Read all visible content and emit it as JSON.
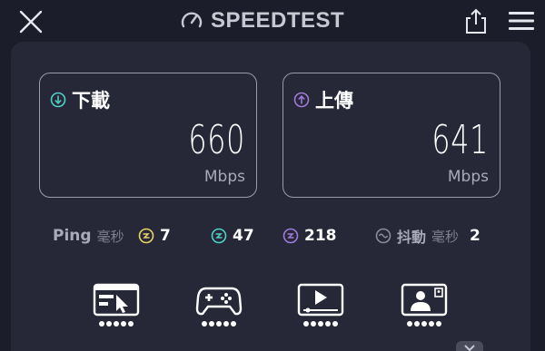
{
  "header": {
    "title": "SPEEDTEST"
  },
  "download": {
    "label": "下載",
    "value": "660",
    "unit": "Mbps"
  },
  "upload": {
    "label": "上傳",
    "value": "641",
    "unit": "Mbps"
  },
  "ping": {
    "label": "Ping",
    "unit_label": "毫秒",
    "idle": "7",
    "download": "47",
    "upload": "218"
  },
  "jitter": {
    "label": "抖動",
    "unit_label": "毫秒",
    "value": "2"
  },
  "activities": [
    {
      "icon": "browsing-icon",
      "rating_dots": 5
    },
    {
      "icon": "gaming-icon",
      "rating_dots": 5
    },
    {
      "icon": "video-streaming-icon",
      "rating_dots": 5
    },
    {
      "icon": "video-call-icon",
      "rating_dots": 5
    }
  ],
  "colors": {
    "background": "#1b1d2a",
    "panel": "#262838",
    "download_accent": "#4fd1c5",
    "upload_accent": "#a07bd8",
    "idle_ping": "#e8d565",
    "text_muted": "#a8aab8"
  }
}
